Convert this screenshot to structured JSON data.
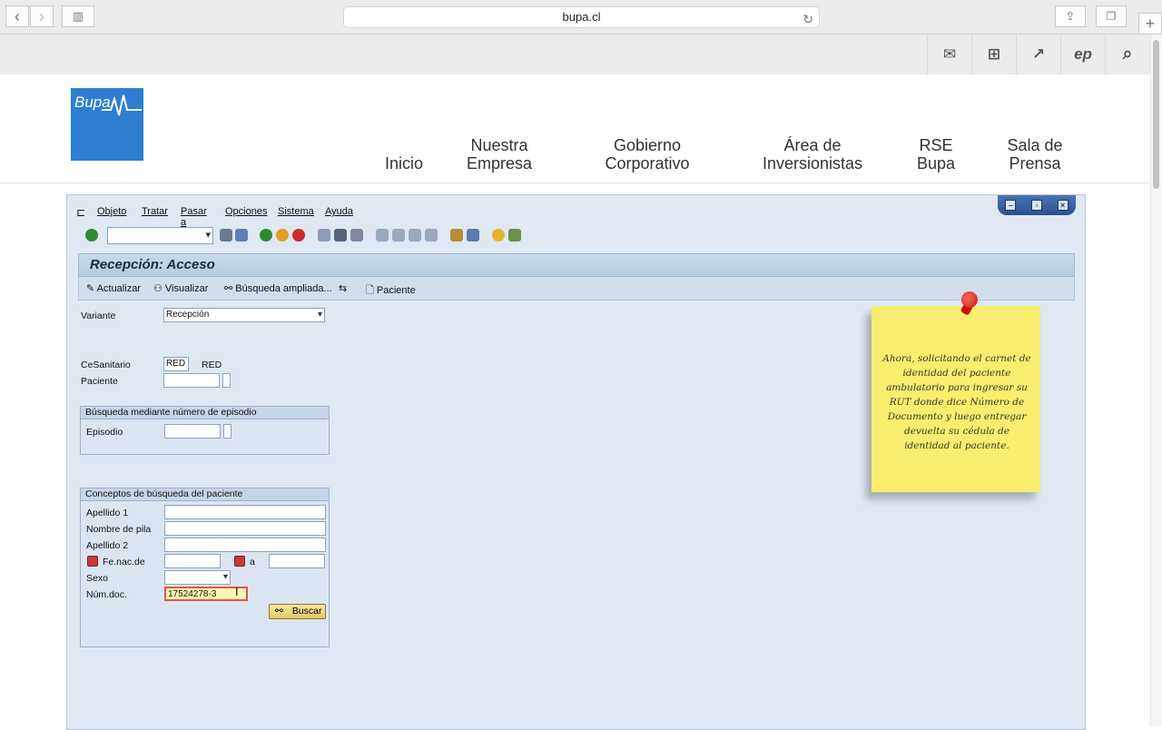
{
  "browser": {
    "url": "bupa.cl"
  },
  "site": {
    "logo_text": "Bupa",
    "utility_icons": [
      "mail-icon",
      "sitemap-icon",
      "external-link-icon",
      "ep-icon",
      "search-icon"
    ],
    "nav": [
      {
        "line1": "Inicio",
        "line2": ""
      },
      {
        "line1": "Nuestra",
        "line2": "Empresa"
      },
      {
        "line1": "Gobierno",
        "line2": "Corporativo"
      },
      {
        "line1": "Área de",
        "line2": "Inversionistas"
      },
      {
        "line1": "RSE",
        "line2": "Bupa"
      },
      {
        "line1": "Sala de",
        "line2": "Prensa"
      }
    ]
  },
  "sap": {
    "menu": [
      "Objeto",
      "Tratar",
      "Pasar a",
      "Opciones",
      "Sistema",
      "Ayuda"
    ],
    "title": "Recepción: Acceso",
    "app_toolbar": [
      "Actualizar",
      "Visualizar",
      "Búsqueda ampliada...",
      "Paciente"
    ],
    "variante": {
      "label": "Variante",
      "value": "Recepción"
    },
    "cesanitario": {
      "label": "CeSanitario",
      "value": "RED",
      "text": "RED"
    },
    "paciente": {
      "label": "Paciente",
      "value": ""
    },
    "group_episodio": {
      "title": "Búsqueda mediante número de episodio",
      "label": "Episodio",
      "value": ""
    },
    "group_conceptos": {
      "title": "Conceptos de búsqueda del paciente",
      "apellido1": {
        "label": "Apellido 1",
        "value": ""
      },
      "nombre": {
        "label": "Nombre de pila",
        "value": ""
      },
      "apellido2": {
        "label": "Apellido 2",
        "value": ""
      },
      "fenac": {
        "label": "Fe.nac.de",
        "to_label": "a"
      },
      "sexo": {
        "label": "Sexo",
        "value": ""
      },
      "numdoc": {
        "label": "Núm.doc.",
        "value": "17524278-3"
      },
      "buscar_label": "Buscar"
    }
  },
  "note": {
    "text": "Ahora, solicitando el carnet de identidad del paciente ambulatorio para ingresar su RUT donde dice Número de Documento y luego entregar devuelta su cédula de identidad al paciente."
  }
}
